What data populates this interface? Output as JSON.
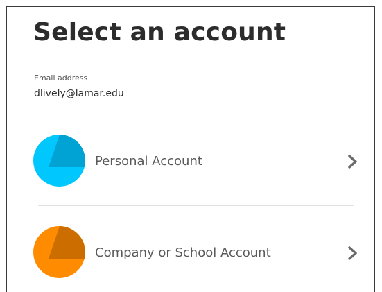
{
  "page": {
    "title": "Select an account"
  },
  "email": {
    "label": "Email address",
    "value": "dlively@lamar.edu"
  },
  "accounts": [
    {
      "label": "Personal Account",
      "icon": "personal-account-avatar-icon",
      "color": "#00c8ff",
      "shade": "#00a3d3"
    },
    {
      "label": "Company or School Account",
      "icon": "company-account-avatar-icon",
      "color": "#ff8c00",
      "shade": "#cc6d00"
    }
  ],
  "colors": {
    "title": "#2c2c2c",
    "label": "#5a5a5a",
    "chevron": "#6b6b6b",
    "divider": "#e2e2e2"
  }
}
